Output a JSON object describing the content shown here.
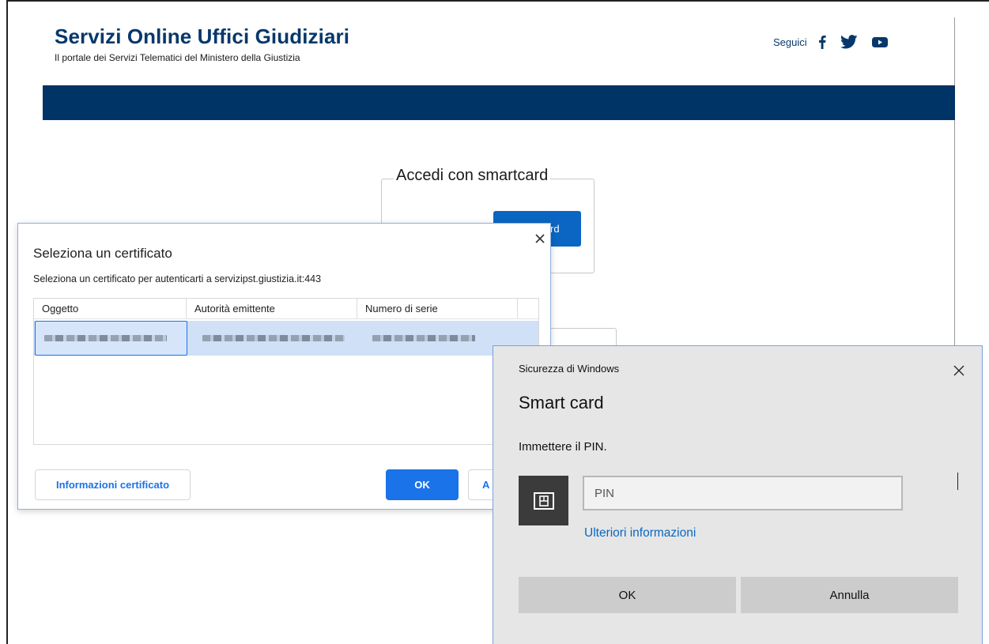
{
  "site": {
    "title": "Servizi Online Uffici Giudiziari",
    "subtitle": "Il portale dei Servizi Telematici del Ministero della Giustizia",
    "social_label": "Seguici",
    "social_icons": [
      "facebook-icon",
      "twitter-icon",
      "youtube-icon"
    ],
    "nav_color": "#003366",
    "title_color": "#06386b"
  },
  "smartcard": {
    "legend": "Accedi con smartcard",
    "button_label_visible": "rd"
  },
  "cert_dialog": {
    "title": "Seleziona un certificato",
    "description": "Seleziona un certificato per autenticarti a servizipst.giustizia.it:443",
    "columns": [
      "Oggetto",
      "Autorità emittente",
      "Numero di serie"
    ],
    "info_button": "Informazioni certificato",
    "ok_button": "OK",
    "cancel_button_visible": "A",
    "accent_color": "#1a73e8"
  },
  "win_dialog": {
    "caption": "Sicurezza di Windows",
    "heading": "Smart card",
    "prompt": "Immettere il PIN.",
    "pin_placeholder": "PIN",
    "more_info_link": "Ulteriori informazioni",
    "ok_button": "OK",
    "cancel_button": "Annulla",
    "link_color": "#0a67c2"
  }
}
